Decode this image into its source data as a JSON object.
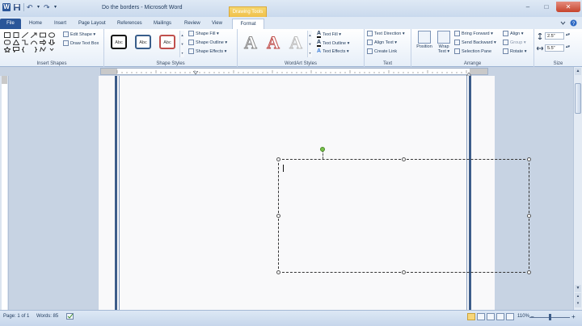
{
  "window": {
    "title": "Do the borders  -  Microsoft Word",
    "context_tab_title": "Drawing Tools",
    "minimize": "–",
    "maximize": "□",
    "close": "✕"
  },
  "quick_access": {
    "app_icon": "W",
    "undo": "↶",
    "redo": "↷",
    "dropdown": "▾"
  },
  "tabs": [
    "File",
    "Home",
    "Insert",
    "Page Layout",
    "References",
    "Mailings",
    "Review",
    "View",
    "Format"
  ],
  "ribbon": {
    "insert_shapes": {
      "label": "Insert Shapes",
      "edit_shape": "Edit Shape ▾",
      "draw_text_box": "Draw Text Box"
    },
    "shape_styles": {
      "label": "Shape Styles",
      "styles": [
        "Abc",
        "Abc",
        "Abc"
      ],
      "shape_fill": "Shape Fill ▾",
      "shape_outline": "Shape Outline ▾",
      "shape_effects": "Shape Effects ▾"
    },
    "wordart_styles": {
      "label": "WordArt Styles",
      "letters": [
        "A",
        "A",
        "A"
      ]
    },
    "text": {
      "label": "Text",
      "text_fill": "Text Fill ▾",
      "text_outline": "Text Outline ▾",
      "text_effects": "Text Effects ▾",
      "text_direction": "Text Direction ▾",
      "align_text": "Align Text ▾",
      "create_link": "Create Link"
    },
    "arrange": {
      "label": "Arrange",
      "position": "Position",
      "wrap_text": "Wrap Text ▾",
      "bring_forward": "Bring Forward ▾",
      "send_backward": "Send Backward ▾",
      "selection_pane": "Selection Pane",
      "align": "Align ▾",
      "group": "Group ▾",
      "rotate": "Rotate ▾"
    },
    "size": {
      "label": "Size",
      "height": "2.5\"",
      "width": "5.5\""
    }
  },
  "status": {
    "page": "Page: 1 of 1",
    "words": "Words: 85",
    "zoom": "110%",
    "zoom_out": "−",
    "zoom_in": "+"
  },
  "colors": {
    "accent": "#2a5699",
    "context_tab": "#f0c04b",
    "page": "#f9f9fa",
    "rotate_handle": "#79c24b"
  }
}
